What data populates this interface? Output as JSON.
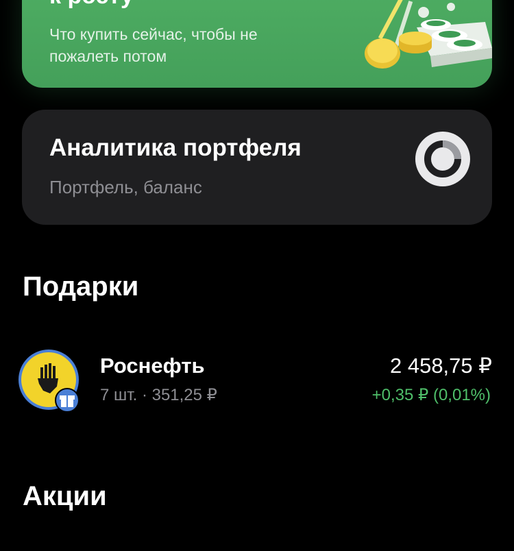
{
  "promo": {
    "title": "к росту",
    "subtitle": "Что купить сейчас, чтобы не пожалеть потом",
    "accent": "#4fae63"
  },
  "analytics": {
    "title": "Аналитика портфеля",
    "subtitle": "Портфель, баланс",
    "icon": "donut-chart-icon"
  },
  "gifts": {
    "heading": "Подарки",
    "items": [
      {
        "name": "Роснефть",
        "meta": "7 шт. · 351,25 ₽",
        "value": "2 458,75 ₽",
        "change": "+0,35 ₽ (0,01%)",
        "logo": "rosneft-logo",
        "badge": "gift-icon",
        "change_color": "#4fbf6a"
      }
    ]
  },
  "stocks": {
    "heading": "Акции"
  }
}
